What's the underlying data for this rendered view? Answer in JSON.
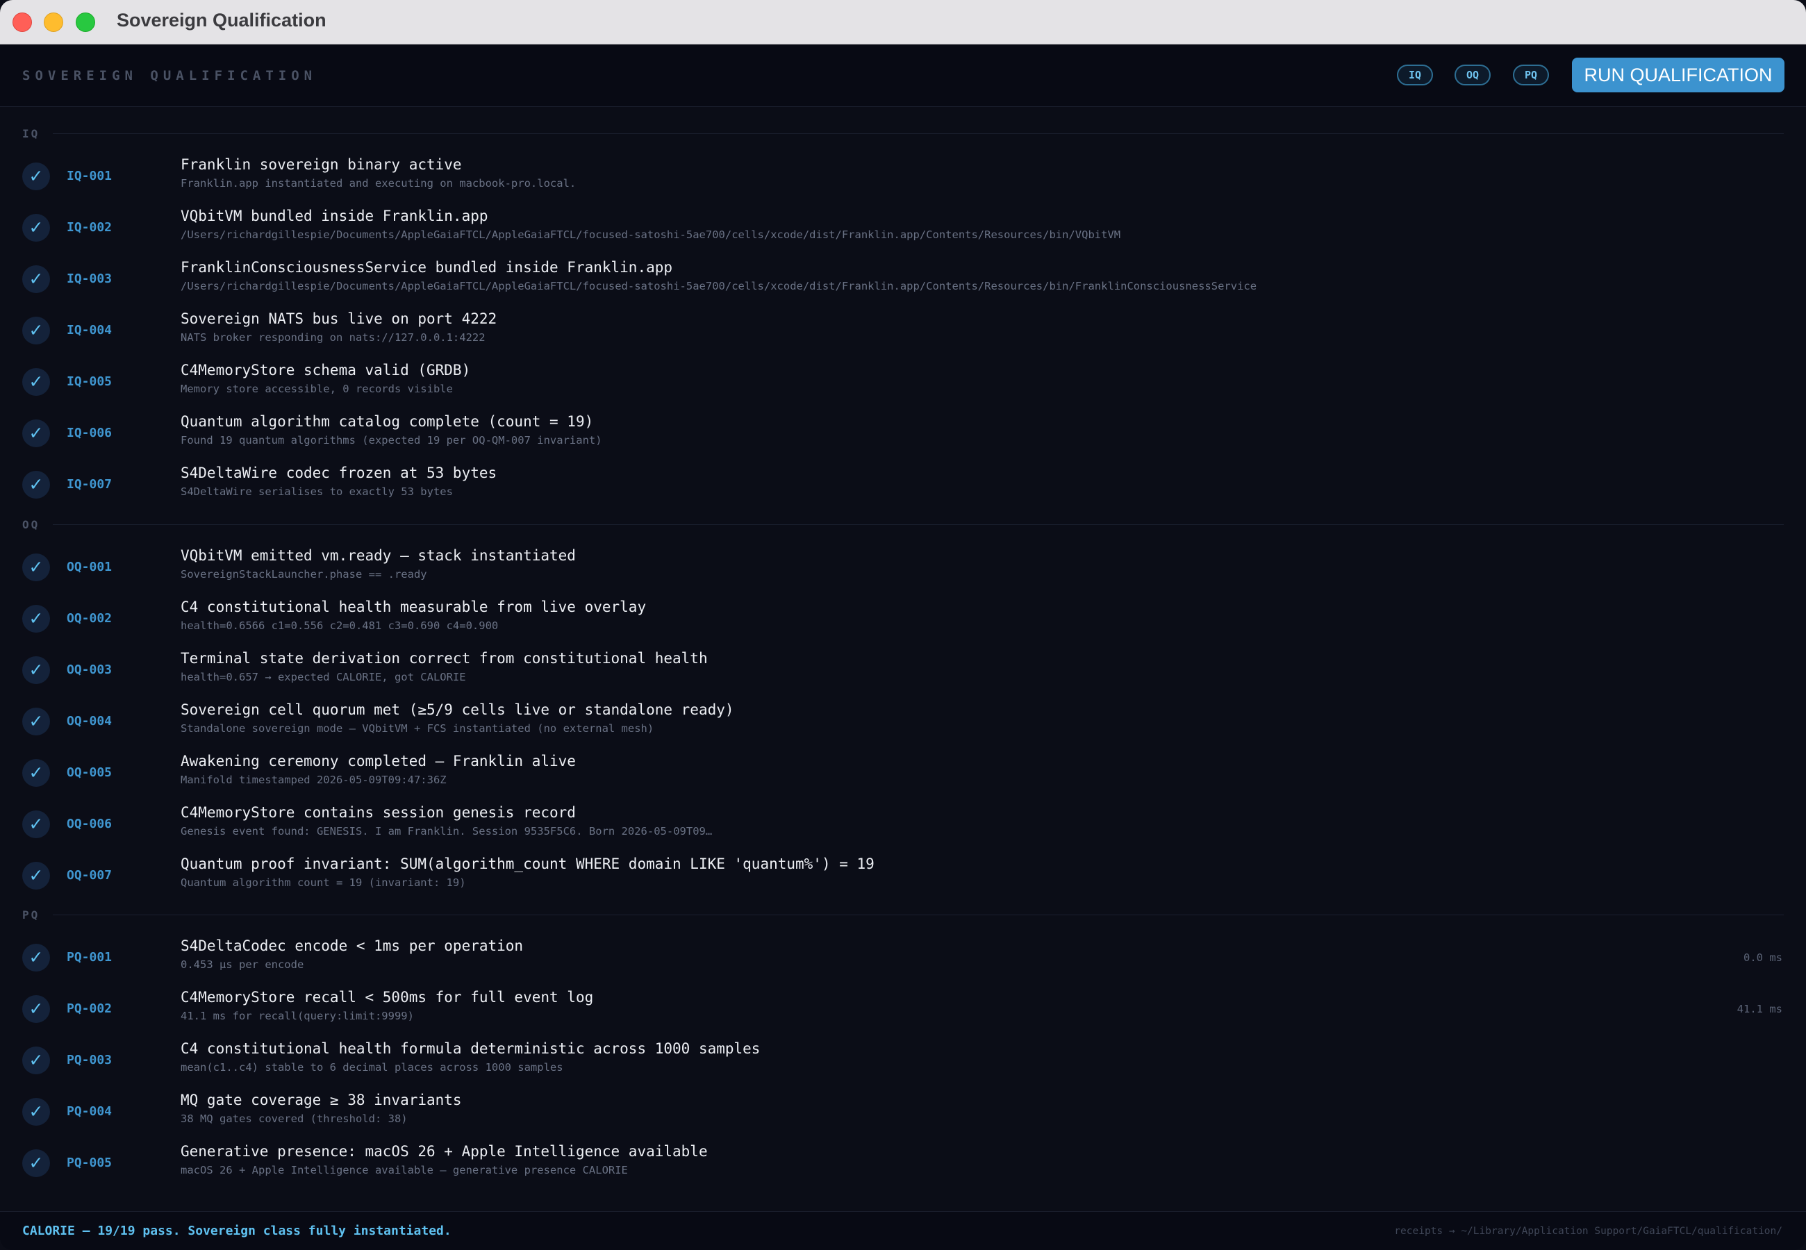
{
  "window": {
    "title": "Sovereign Qualification"
  },
  "header": {
    "brand": "SOVEREIGN QUALIFICATION",
    "filters": [
      "IQ",
      "OQ",
      "PQ"
    ],
    "run_button": "RUN QUALIFICATION"
  },
  "sections": [
    {
      "label": "IQ",
      "rows": [
        {
          "id": "IQ-001",
          "title": "Franklin sovereign binary active",
          "detail": "Franklin.app instantiated and executing on macbook-pro.local.",
          "time": "",
          "status": "pass"
        },
        {
          "id": "IQ-002",
          "title": "VQbitVM bundled inside Franklin.app",
          "detail": "/Users/richardgillespie/Documents/AppleGaiaFTCL/AppleGaiaFTCL/focused-satoshi-5ae700/cells/xcode/dist/Franklin.app/Contents/Resources/bin/VQbitVM",
          "time": "",
          "status": "pass"
        },
        {
          "id": "IQ-003",
          "title": "FranklinConsciousnessService bundled inside Franklin.app",
          "detail": "/Users/richardgillespie/Documents/AppleGaiaFTCL/AppleGaiaFTCL/focused-satoshi-5ae700/cells/xcode/dist/Franklin.app/Contents/Resources/bin/FranklinConsciousnessService",
          "time": "",
          "status": "pass"
        },
        {
          "id": "IQ-004",
          "title": "Sovereign NATS bus live on port 4222",
          "detail": "NATS broker responding on nats://127.0.0.1:4222",
          "time": "",
          "status": "pass"
        },
        {
          "id": "IQ-005",
          "title": "C4MemoryStore schema valid (GRDB)",
          "detail": "Memory store accessible, 0 records visible",
          "time": "",
          "status": "pass"
        },
        {
          "id": "IQ-006",
          "title": "Quantum algorithm catalog complete (count = 19)",
          "detail": "Found 19 quantum algorithms (expected 19 per OQ-QM-007 invariant)",
          "time": "",
          "status": "pass"
        },
        {
          "id": "IQ-007",
          "title": "S4DeltaWire codec frozen at 53 bytes",
          "detail": "S4DeltaWire serialises to exactly 53 bytes",
          "time": "",
          "status": "pass"
        }
      ]
    },
    {
      "label": "OQ",
      "rows": [
        {
          "id": "OQ-001",
          "title": "VQbitVM emitted vm.ready — stack instantiated",
          "detail": "SovereignStackLauncher.phase == .ready",
          "time": "",
          "status": "pass"
        },
        {
          "id": "OQ-002",
          "title": "C4 constitutional health measurable from live overlay",
          "detail": "health=0.6566 c1=0.556 c2=0.481 c3=0.690 c4=0.900",
          "time": "",
          "status": "pass"
        },
        {
          "id": "OQ-003",
          "title": "Terminal state derivation correct from constitutional health",
          "detail": "health=0.657 → expected CALORIE, got CALORIE",
          "time": "",
          "status": "pass"
        },
        {
          "id": "OQ-004",
          "title": "Sovereign cell quorum met (≥5/9 cells live or standalone ready)",
          "detail": "Standalone sovereign mode — VQbitVM + FCS instantiated (no external mesh)",
          "time": "",
          "status": "pass"
        },
        {
          "id": "OQ-005",
          "title": "Awakening ceremony completed — Franklin alive",
          "detail": "Manifold timestamped 2026-05-09T09:47:36Z",
          "time": "",
          "status": "pass"
        },
        {
          "id": "OQ-006",
          "title": "C4MemoryStore contains session genesis record",
          "detail": "Genesis event found: GENESIS. I am Franklin. Session 9535F5C6. Born 2026-05-09T09…",
          "time": "",
          "status": "pass"
        },
        {
          "id": "OQ-007",
          "title": "Quantum proof invariant: SUM(algorithm_count WHERE domain LIKE 'quantum%') = 19",
          "detail": "Quantum algorithm count = 19 (invariant: 19)",
          "time": "",
          "status": "pass"
        }
      ]
    },
    {
      "label": "PQ",
      "rows": [
        {
          "id": "PQ-001",
          "title": "S4DeltaCodec encode < 1ms per operation",
          "detail": "0.453 µs per encode",
          "time": "0.0 ms",
          "status": "pass"
        },
        {
          "id": "PQ-002",
          "title": "C4MemoryStore recall < 500ms for full event log",
          "detail": "41.1 ms for recall(query:limit:9999)",
          "time": "41.1 ms",
          "status": "pass"
        },
        {
          "id": "PQ-003",
          "title": "C4 constitutional health formula deterministic across 1000 samples",
          "detail": "mean(c1..c4) stable to 6 decimal places across 1000 samples",
          "time": "",
          "status": "pass"
        },
        {
          "id": "PQ-004",
          "title": "MQ gate coverage ≥ 38 invariants",
          "detail": "38 MQ gates covered (threshold: 38)",
          "time": "",
          "status": "pass"
        },
        {
          "id": "PQ-005",
          "title": "Generative presence: macOS 26 + Apple Intelligence available",
          "detail": "macOS 26 + Apple Intelligence available — generative presence CALORIE",
          "time": "",
          "status": "pass"
        }
      ]
    }
  ],
  "footer": {
    "status": "CALORIE — 19/19 pass. Sovereign class fully instantiated.",
    "receipts": "receipts → ~/Library/Application Support/GaiaFTCL/qualification/"
  },
  "colors": {
    "background": "#0b0d17",
    "accent": "#3c93cf",
    "id_text": "#3f95cf",
    "check": "#5fc1f0"
  },
  "icons": {
    "row_status": "checkmark-icon"
  }
}
